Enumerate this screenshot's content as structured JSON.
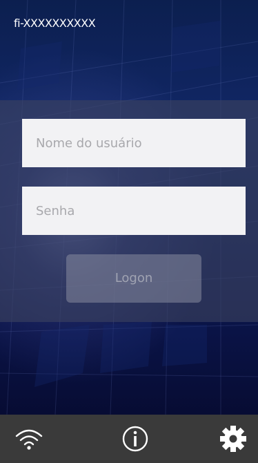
{
  "header": {
    "device_id": "fi-XXXXXXXXXX"
  },
  "login": {
    "username_placeholder": "Nome do usuário",
    "password_placeholder": "Senha",
    "logon_label": "Logon"
  },
  "bottombar": {
    "icons": [
      "wifi-icon",
      "info-icon",
      "gear-icon"
    ]
  },
  "colors": {
    "bottombar_bg": "#3a3a3a",
    "field_bg": "#f2f2f4",
    "panel_overlay": "#3c4260"
  }
}
